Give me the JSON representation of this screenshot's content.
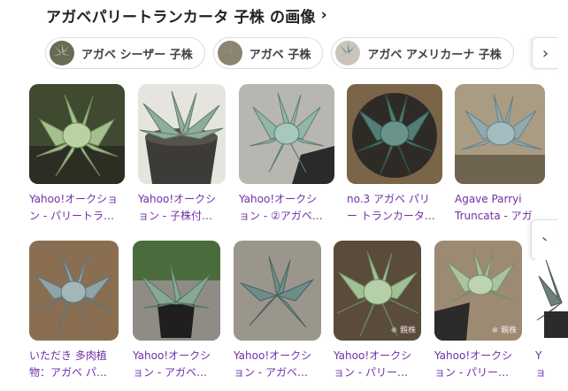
{
  "header": {
    "title": "アガベパリートランカータ 子株 の画像",
    "chevron": "›"
  },
  "chips": [
    {
      "label": "アガベ シーザー 子株",
      "icon": "agave-thumb-icon"
    },
    {
      "label": "アガベ 子株",
      "icon": "agave-thumb-icon"
    },
    {
      "label": "アガベ アメリカーナ 子株",
      "icon": "agave-thumb-icon"
    }
  ],
  "nav": {
    "next_symbol": "›"
  },
  "row1": [
    {
      "line1": "Yahoo!オークショ",
      "line2": "ン - パリートラ…",
      "bg": "#6a7d55",
      "leaf": "#9ab88a"
    },
    {
      "line1": "Yahoo!オークシ",
      "line2": "ョン - 子株付…",
      "bg": "#d8d6cf",
      "leaf": "#7f9e8a"
    },
    {
      "line1": "Yahoo!オークシ",
      "line2": "ョン - ②アガベ…",
      "bg": "#b9b7b1",
      "leaf": "#8fb1a6"
    },
    {
      "line1": "no.3 アガベ パリ",
      "line2": "ー トランカータ…",
      "bg": "#8c7657",
      "leaf": "#4f7a73"
    },
    {
      "line1": "Agave Parryi",
      "line2": "Truncata - アガ",
      "bg": "#a69a82",
      "leaf": "#8aa4aa"
    }
  ],
  "row2": [
    {
      "line1": "いただき 多肉植",
      "line2": "物：アガベ パ…",
      "bg": "#8a6e52",
      "leaf": "#8fa4a4"
    },
    {
      "line1": "Yahoo!オークシ",
      "line2": "ョン - アガベ…",
      "bg": "#6e7260",
      "leaf": "#7f9d8e"
    },
    {
      "line1": "Yahoo!オークシ",
      "line2": "ョン - アガベ…",
      "bg": "#9b968c",
      "leaf": "#6f8d88"
    },
    {
      "line1": "Yahoo!オークシ",
      "line2": "ョン - パリー…",
      "bg": "#5b4b3b",
      "leaf": "#9fbf95",
      "watermark": "※ 親株"
    },
    {
      "line1": "Yahoo!オークシ",
      "line2": "ョン - パリー…",
      "bg": "#9d8a73",
      "leaf": "#a9c2a0",
      "watermark": "※ 親株"
    },
    {
      "line1": "Y",
      "line2": "ョ",
      "bg": "#ffffff",
      "leaf": "#6f7f7a"
    }
  ]
}
